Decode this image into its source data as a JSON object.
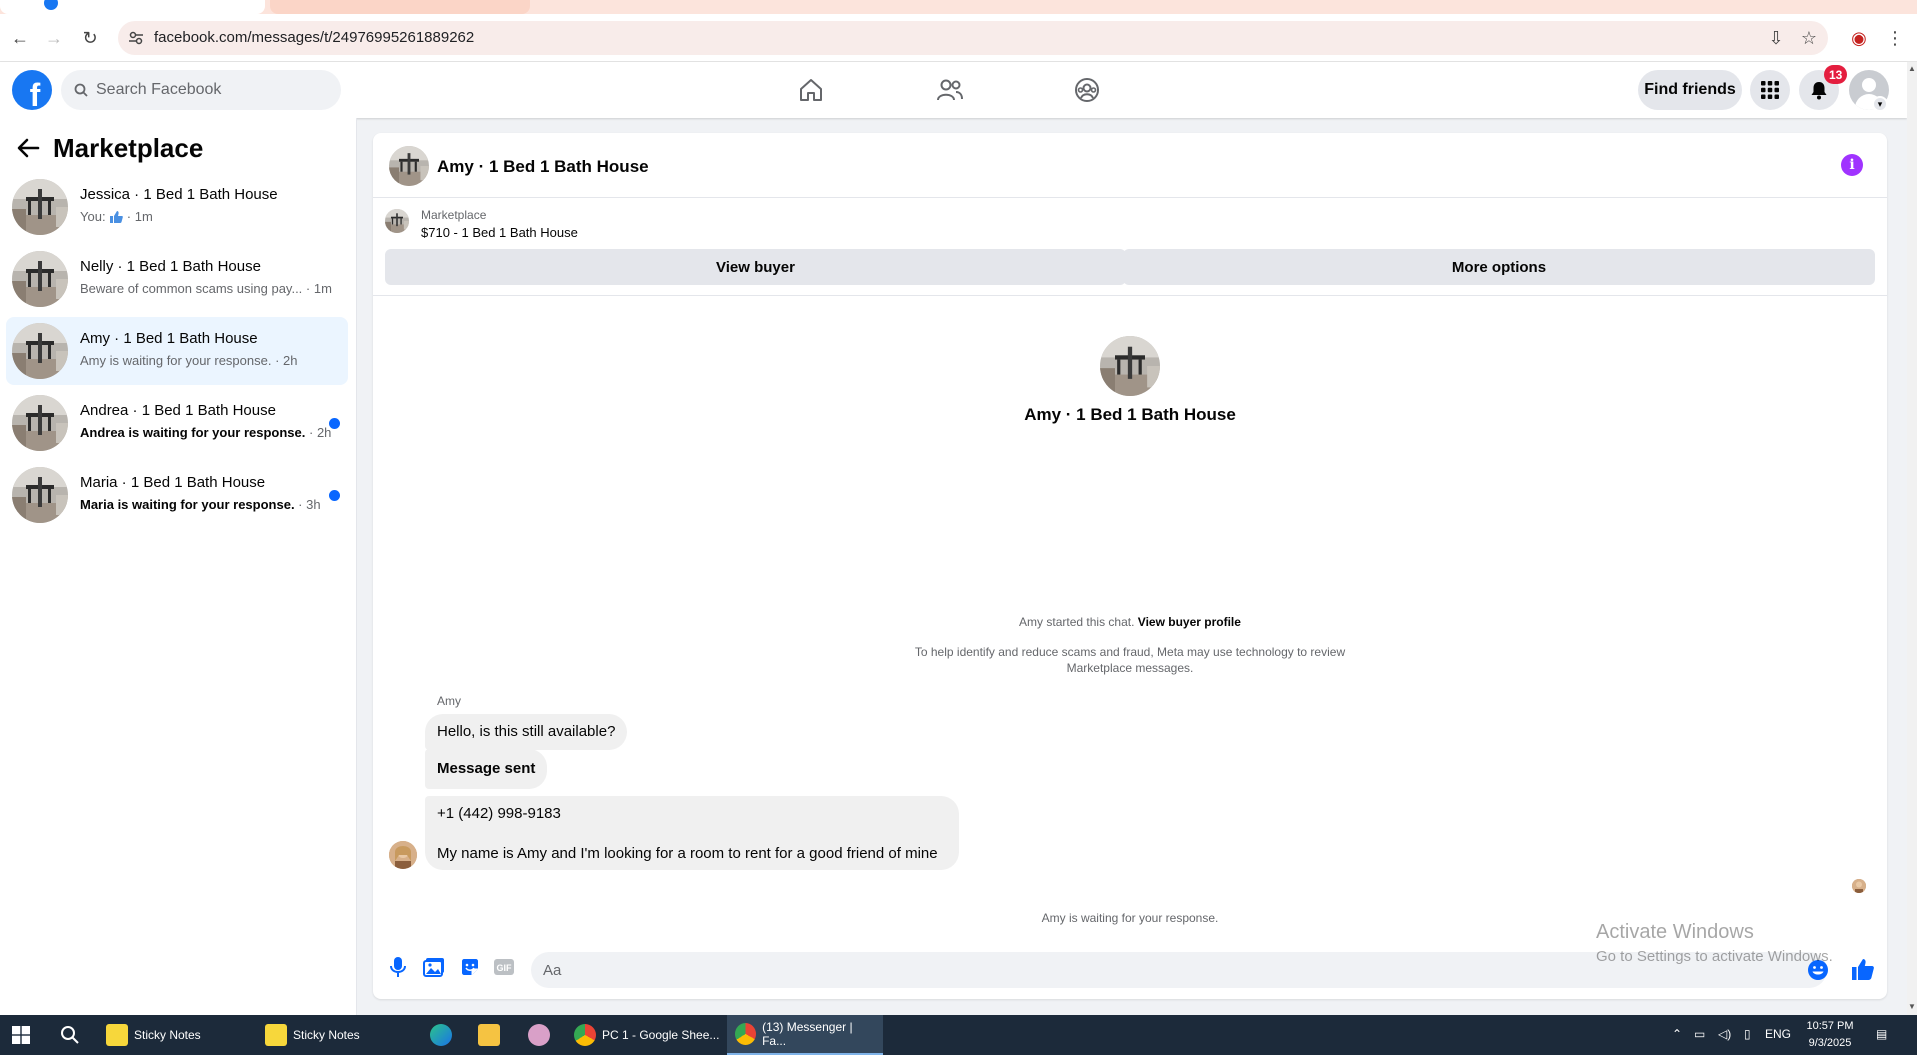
{
  "browser": {
    "url": "facebook.com/messages/t/24976995261889262"
  },
  "header": {
    "search_placeholder": "Search Facebook",
    "find_friends_label": "Find friends",
    "notification_count": "13"
  },
  "sidebar": {
    "title": "Marketplace",
    "conversations": [
      {
        "name": "Jessica · 1 Bed 1 Bath House",
        "preview_prefix": "You: ",
        "preview": "",
        "time": " · 1m",
        "unread": false,
        "active": false
      },
      {
        "name": "Nelly · 1 Bed 1 Bath House",
        "preview": "Beware of common scams using pay...",
        "time": " · 1m",
        "unread": false,
        "active": false
      },
      {
        "name": "Amy · 1 Bed 1 Bath House",
        "preview": "Amy is waiting for your response.",
        "time": " · 2h",
        "unread": false,
        "active": true
      },
      {
        "name": "Andrea · 1 Bed 1 Bath House",
        "preview": "Andrea is waiting for your response.",
        "time": " · 2h",
        "unread": true,
        "active": false
      },
      {
        "name": "Maria · 1 Bed 1 Bath House",
        "preview": "Maria is waiting for your response.",
        "time": " · 3h",
        "unread": true,
        "active": false
      }
    ]
  },
  "chat": {
    "title": "Amy · 1 Bed 1 Bath House",
    "listing_source": "Marketplace",
    "listing_price": "$710 - 1 Bed 1 Bath House",
    "view_buyer_label": "View buyer",
    "more_options_label": "More options",
    "profile_name": "Amy · 1 Bed 1 Bath House",
    "started_text": "Amy started this chat.",
    "view_buyer_profile_label": "View buyer profile",
    "meta_note": "To help identify and reduce scams and fraud, Meta may use technology to review Marketplace messages.",
    "sender_name": "Amy",
    "messages": [
      "Hello, is this still available?",
      "Message sent",
      "+1 (442) 998-9183",
      "My name is Amy and I'm looking for a room to rent for a good friend of mine"
    ],
    "waiting_text": "Amy is waiting for your response.",
    "composer_placeholder": "Aa"
  },
  "watermark": {
    "line1": "Activate Windows",
    "line2": "Go to Settings to activate Windows."
  },
  "taskbar": {
    "apps": [
      {
        "label": "Sticky Notes"
      },
      {
        "label": "Sticky Notes"
      },
      {
        "label": "PC 1 - Google Shee..."
      },
      {
        "label": "(13) Messenger | Fa..."
      }
    ],
    "language": "ENG",
    "time": "10:57 PM",
    "date": "9/3/2025"
  }
}
